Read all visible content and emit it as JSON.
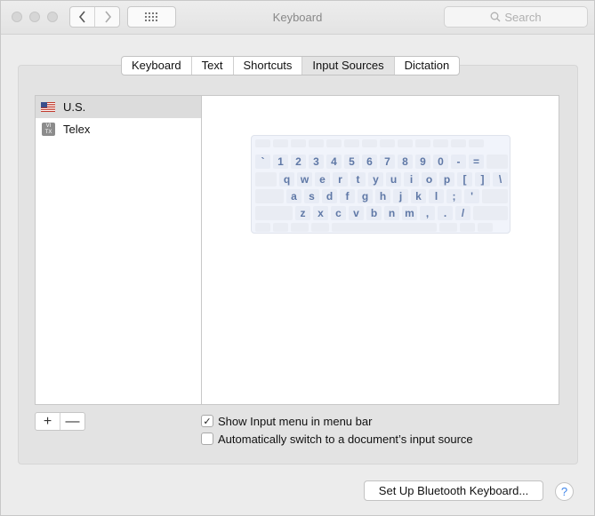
{
  "window": {
    "title": "Keyboard",
    "search_placeholder": "Search"
  },
  "tabs": [
    {
      "label": "Keyboard"
    },
    {
      "label": "Text"
    },
    {
      "label": "Shortcuts"
    },
    {
      "label": "Input Sources",
      "active": true
    },
    {
      "label": "Dictation"
    }
  ],
  "input_sources": [
    {
      "label": "U.S.",
      "icon": "us-flag-icon",
      "selected": true
    },
    {
      "label": "Telex",
      "icon": "vietnamese-telex-icon",
      "icon_text_top": "VI",
      "icon_text_bottom": "TX"
    }
  ],
  "keyboard_preview": {
    "row1": [
      "`",
      "1",
      "2",
      "3",
      "4",
      "5",
      "6",
      "7",
      "8",
      "9",
      "0",
      "-",
      "="
    ],
    "row2": [
      "q",
      "w",
      "e",
      "r",
      "t",
      "y",
      "u",
      "i",
      "o",
      "p",
      "[",
      "]",
      "\\"
    ],
    "row3": [
      "a",
      "s",
      "d",
      "f",
      "g",
      "h",
      "j",
      "k",
      "l",
      ";",
      "'"
    ],
    "row4": [
      "z",
      "x",
      "c",
      "v",
      "b",
      "n",
      "m",
      ",",
      ".",
      "/"
    ]
  },
  "list_controls": {
    "add_label": "+",
    "remove_label": "—"
  },
  "options": {
    "show_input_menu": {
      "label": "Show Input menu in menu bar",
      "checked": true,
      "check_mark": "✓"
    },
    "auto_switch": {
      "label": "Automatically switch to a document’s input source",
      "checked": false
    }
  },
  "footer": {
    "bluetooth_label": "Set Up Bluetooth Keyboard...",
    "help_label": "?"
  },
  "colors": {
    "key_text": "#5f78a6",
    "selection": "#dcdcdc",
    "help_accent": "#3b83ea"
  }
}
